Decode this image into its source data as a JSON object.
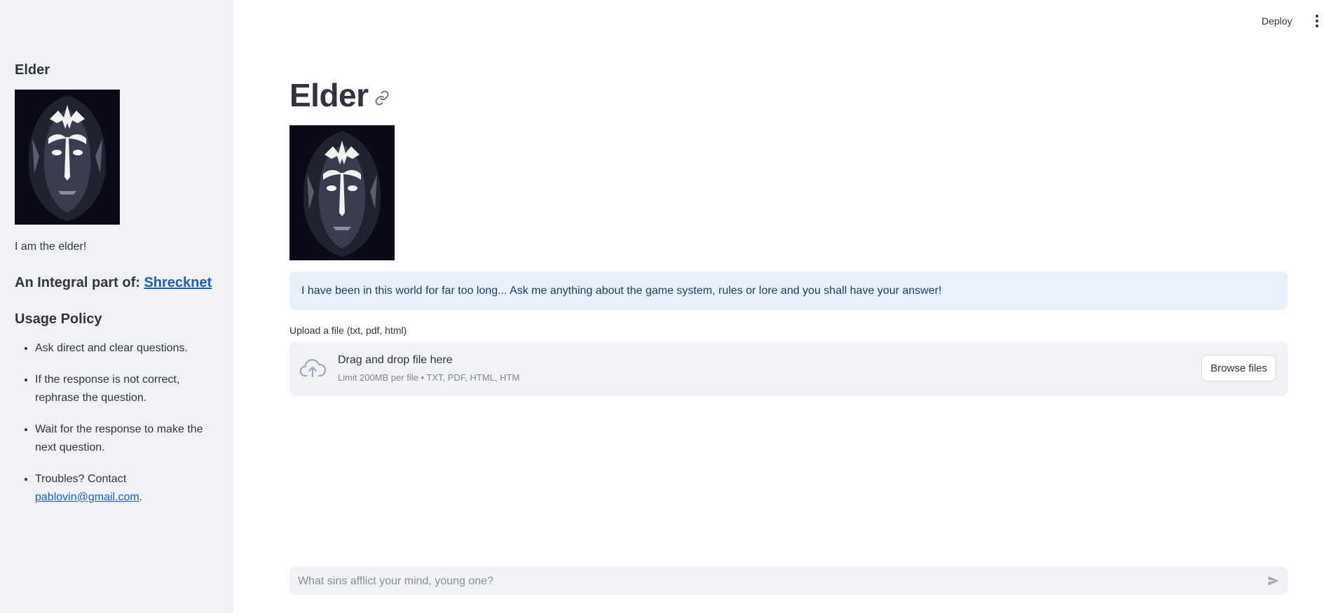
{
  "sidebar": {
    "title": "Elder",
    "caption": "I am the elder!",
    "integral_prefix": "An Integral part of: ",
    "integral_link": "Shrecknet",
    "usage_title": "Usage Policy",
    "policy": [
      "Ask direct and clear questions.",
      "If the response is not correct, rephrase the question.",
      "Wait for the response to make the next question."
    ],
    "contact_prefix": "Troubles? Contact ",
    "contact_email": "pablovin@gmail.com",
    "contact_suffix": "."
  },
  "toolbar": {
    "deploy_label": "Deploy",
    "menu_icon": "kebab-menu-icon"
  },
  "main": {
    "title": "Elder",
    "info_text": "I have been in this world for far too long... Ask me anything about the game system, rules or lore and you shall have your answer!",
    "upload_label": "Upload a file (txt, pdf, html)",
    "dropzone_title": "Drag and drop file here",
    "dropzone_subtitle": "Limit 200MB per file • TXT, PDF, HTML, HTM",
    "browse_label": "Browse files",
    "chat_placeholder": "What sins afflict your mind, young one?"
  },
  "colors": {
    "sidebar_bg": "#F0F2F6",
    "info_bg": "#E8F1FB",
    "link": "#1a5fb4",
    "text": "#31333F"
  }
}
